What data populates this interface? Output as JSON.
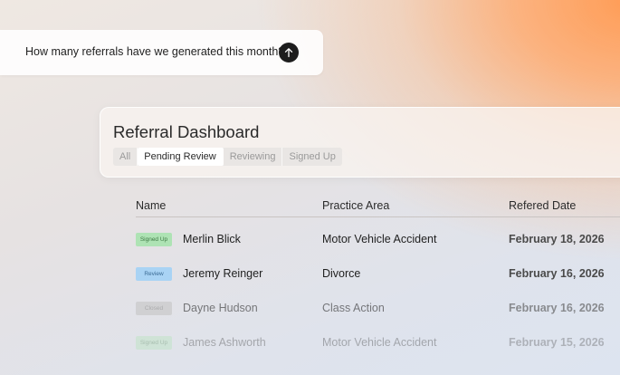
{
  "prompt": {
    "text": "How many referrals have we generated this month?"
  },
  "dashboard": {
    "title": "Referral Dashboard",
    "tabs": [
      {
        "label": "All"
      },
      {
        "label": "Pending Review"
      },
      {
        "label": "Reviewing"
      },
      {
        "label": "Signed Up"
      }
    ],
    "active_tab": "Pending Review"
  },
  "table": {
    "headers": {
      "name": "Name",
      "practice_area": "Practice Area",
      "date": "Refered Date"
    },
    "rows": [
      {
        "status": "Signed Up",
        "name": "Merlin Blick",
        "practice_area": "Motor Vehicle Accident",
        "date": "February 18, 2026"
      },
      {
        "status": "Review",
        "name": "Jeremy Reinger",
        "practice_area": "Divorce",
        "date": "February 16, 2026"
      },
      {
        "status": "Closed",
        "name": "Dayne Hudson",
        "practice_area": "Class Action",
        "date": "February 16, 2026"
      },
      {
        "status": "Signed Up",
        "name": "James Ashworth",
        "practice_area": "Motor Vehicle Accident",
        "date": "February 15, 2026"
      }
    ]
  },
  "colors": {
    "signed_up_bg": "#aee3b4",
    "signed_up_fg": "#3f7a46",
    "review_bg": "#a9d3f4",
    "review_fg": "#3a6b94",
    "closed_bg": "#c6c6c6",
    "closed_fg": "#8a8a8a",
    "accent_orange": "#ff9c55"
  }
}
